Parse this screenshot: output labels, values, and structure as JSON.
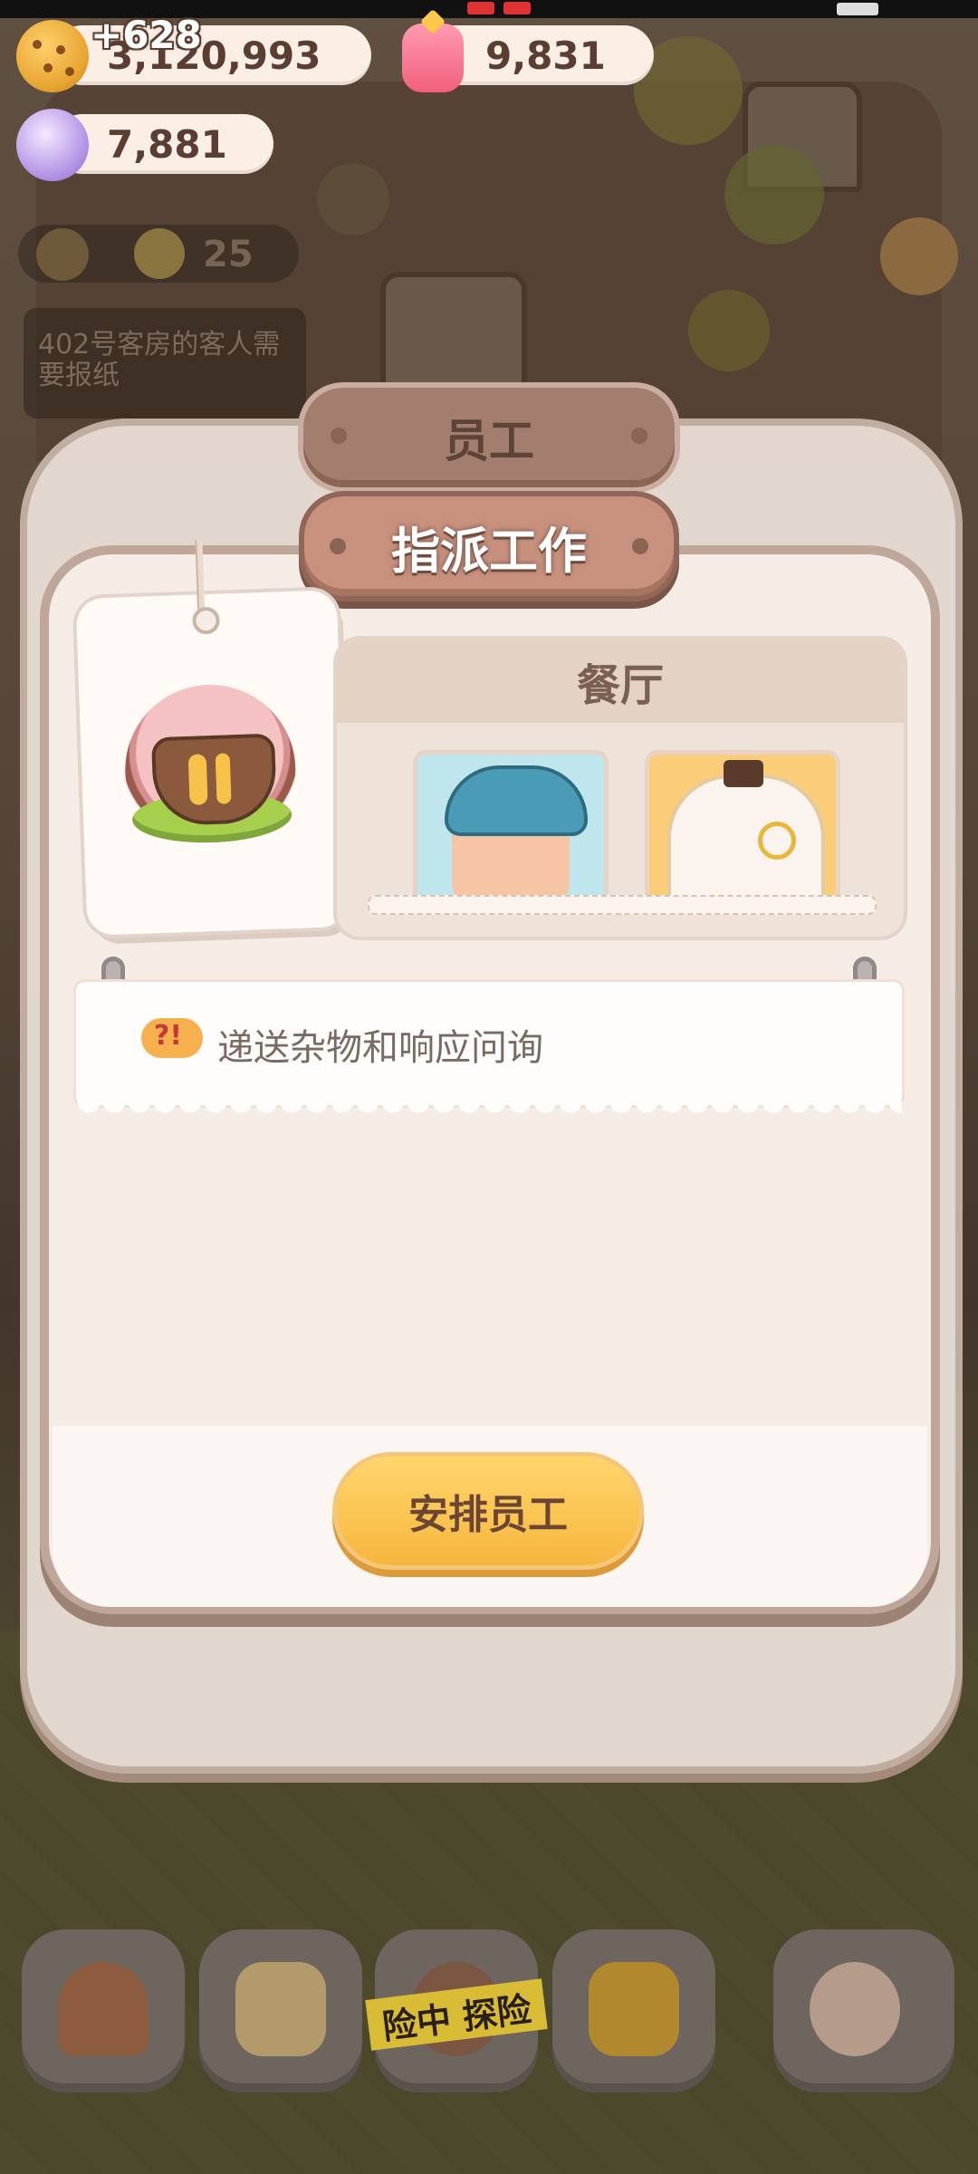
{
  "resources": {
    "cookies": "3,120,993",
    "cookie_gain": "+628",
    "jelly": "9,831",
    "candy": "7,881"
  },
  "hint": {
    "count": "25",
    "notice": "402号客房的客人需要报纸"
  },
  "modal": {
    "title": "员工",
    "subtitle": "指派工作",
    "department": "餐厅",
    "description": "递送杂物和响应问询",
    "assign_button": "安排员工"
  },
  "nav": {
    "explore_label": "险中 探险"
  },
  "staff": [
    {
      "icon": "boy-cap-portrait"
    },
    {
      "icon": "cat-monocle-portrait"
    }
  ],
  "colors": {
    "accent_button": "#f6b63e",
    "plaque": "#c7917e",
    "panel_bg": "#f6ece6"
  }
}
